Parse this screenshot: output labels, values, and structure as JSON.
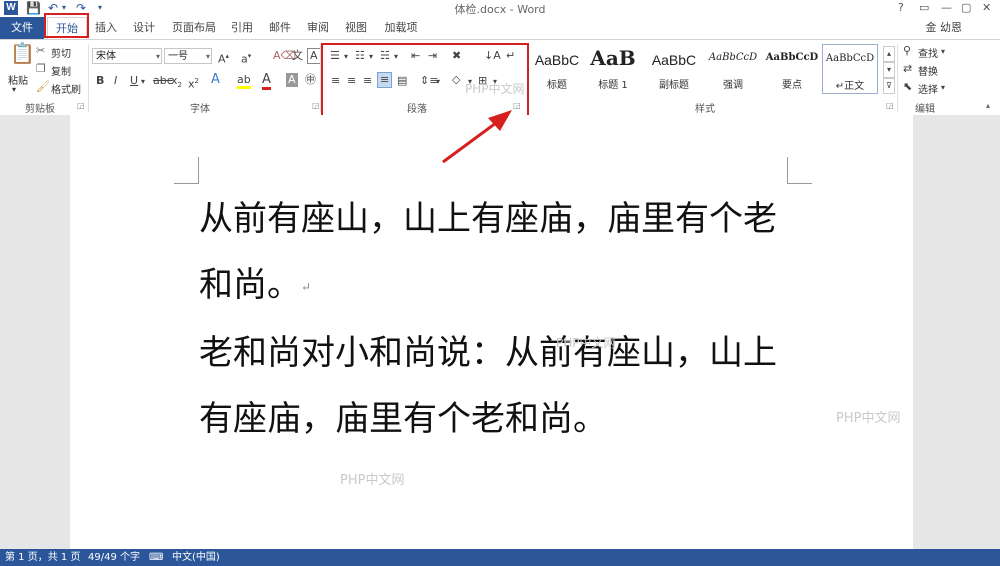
{
  "app": {
    "document_title": "体检.docx - Word",
    "user": "金 幼恩"
  },
  "tabs": [
    "文件",
    "开始",
    "插入",
    "设计",
    "页面布局",
    "引用",
    "邮件",
    "审阅",
    "视图",
    "加载项"
  ],
  "clipboard": {
    "paste": "粘贴",
    "cut": "剪切",
    "copy": "复制",
    "format_painter": "格式刷",
    "group": "剪贴板"
  },
  "font": {
    "name": "宋体",
    "size": "一号",
    "group": "字体"
  },
  "paragraph": {
    "group": "段落"
  },
  "styles": {
    "items": [
      {
        "sample": "AaBbC",
        "name": "标题"
      },
      {
        "sample": "AaB",
        "name": "标题 1"
      },
      {
        "sample": "AaBbC",
        "name": "副标题"
      },
      {
        "sample": "AaBbCcD",
        "name": "强调"
      },
      {
        "sample": "AaBbCcD",
        "name": "要点"
      },
      {
        "sample": "AaBbCcD",
        "name": "↵正文"
      }
    ],
    "group": "样式"
  },
  "editing": {
    "find": "查找",
    "replace": "替换",
    "select": "选择",
    "group": "编辑"
  },
  "document": {
    "paragraphs": [
      "从前有座山，山上有座庙，庙里有个老和尚。",
      "老和尚对小和尚说：从前有座山，山上有座庙，庙里有个老和尚。"
    ]
  },
  "watermarks": [
    "PHP中文网",
    "PHP中文网",
    "PHP中文网",
    "PHP中文网"
  ],
  "status": {
    "page": "第 1 页，共 1 页",
    "words": "49/49 个字",
    "language": "中文(中国)"
  },
  "colors": {
    "accent": "#2b579a",
    "highlight_box": "#d62020"
  }
}
